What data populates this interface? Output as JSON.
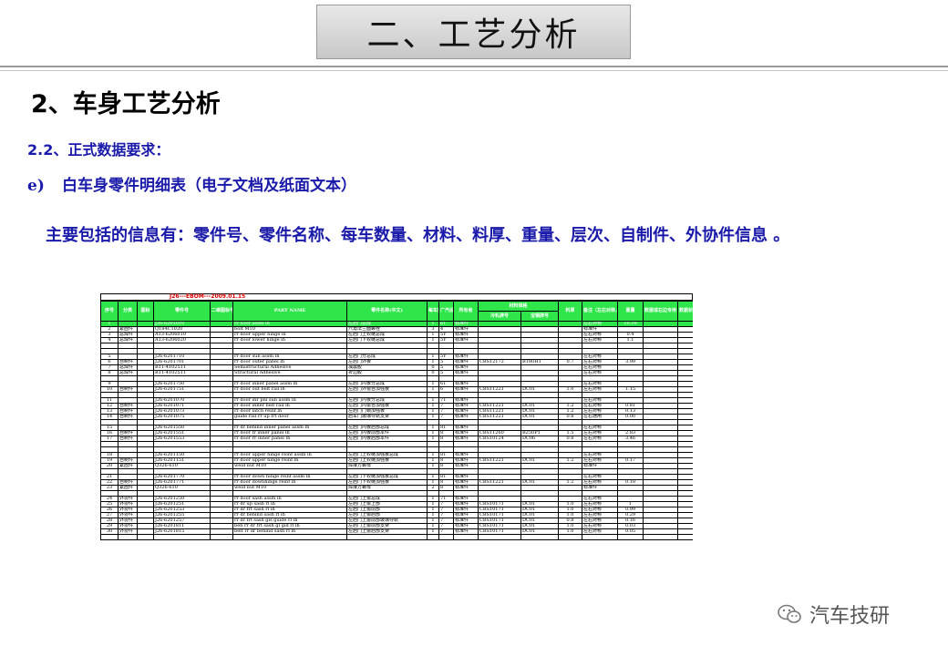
{
  "slide": {
    "title": "二、工艺分析",
    "heading": "2、车身工艺分析",
    "subheading": "2.2、正式数据要求：",
    "item_marker": "e)",
    "item_text": "白车身零件明细表（电子文档及纸面文本）",
    "paragraph": "主要包括的信息有：零件号、零件名称、每车数量、材料、料厚、重量、层次、自制件、外协件信息 。"
  },
  "sheet": {
    "title": "J26---EBOM---2009.01.15",
    "headers": [
      "序号",
      "分类",
      "图标",
      "零件号",
      "二维图标号",
      "PART NAME",
      "零件名称(中文)",
      "每车数量",
      "广汽设计的标识",
      "所有者",
      "冷轧牌号",
      "宝钢牌号",
      "料厚",
      "备注（左右对称，标准件）",
      "重量",
      "数据或右边专用",
      "数据状态（如是是否填写为\"Y\"）"
    ],
    "material_group": "材料规格",
    "rows": [
      [
        "1",
        "",
        "",
        "J26-6201010",
        "",
        "rr door assm lh",
        "左后门总成",
        "1",
        "6T",
        "标准件",
        "",
        "",
        "",
        "左右对称",
        "10.39",
        "",
        ""
      ],
      [
        "2",
        "紧固件",
        "",
        "Q184C1020",
        "",
        "bolt M10",
        "六角法兰面螺栓",
        "3",
        "4",
        "标准件",
        "",
        "",
        "",
        "标准件",
        "",
        "",
        ""
      ],
      [
        "3",
        "总焊件",
        "",
        "A13-6206010",
        "",
        "rr door upper hinge lh",
        "左后门上铰链总成",
        "1",
        "5Y",
        "标准件",
        "",
        "",
        "",
        "左右对称",
        "0.4",
        "",
        ""
      ],
      [
        "4",
        "总焊件",
        "",
        "A13-6206020",
        "",
        "rr door lower hinge lh",
        "左后门下铰链总成",
        "1",
        "5Y",
        "标准件",
        "",
        "",
        "",
        "左右对称",
        "1.1",
        "",
        ""
      ],
      [
        "",
        "",
        "",
        "",
        "",
        "",
        "",
        "",
        "",
        "",
        "",
        "",
        "",
        "",
        "",
        "",
        ""
      ],
      [
        "",
        "",
        "",
        "",
        "",
        "",
        "",
        "",
        "",
        "",
        "",
        "",
        "",
        "",
        "",
        "",
        ""
      ],
      [
        "5",
        "",
        "",
        "J26-6201710",
        "",
        "rr door sub assm lh",
        "左后门分总成",
        "1",
        "5Y",
        "标准件",
        "",
        "",
        "",
        "左右对称",
        "",
        "",
        ""
      ],
      [
        "6",
        "自制件",
        "",
        "J26-6201701",
        "",
        "rr door outer panel lh",
        "左后门外板",
        "1",
        "5",
        "标准件",
        "CBS12172",
        "B180H1",
        "0.7",
        "左右对称",
        "3.99",
        "",
        ""
      ],
      [
        "7",
        "总焊件",
        "",
        "B11-4102511",
        "",
        "Semistructural Adhesive",
        "减震胶",
        "0",
        "5",
        "标准件",
        "",
        "",
        "",
        "左右对称",
        "",
        "",
        ""
      ],
      [
        "8",
        "总焊件",
        "",
        "B11-4102511",
        "",
        "Structural Adhesive",
        "折边胶",
        "0",
        "5",
        "标准件",
        "",
        "",
        "",
        "左右对称",
        "",
        "",
        ""
      ],
      [
        "",
        "",
        "",
        "",
        "",
        "",
        "",
        "",
        "",
        "",
        "",
        "",
        "",
        "",
        "",
        "",
        ""
      ],
      [
        "9",
        "",
        "",
        "J26-6201750",
        "",
        "rr door inner panel assm lh",
        "左后门内板分总成",
        "1",
        "6T",
        "标准件",
        "",
        "",
        "",
        "左右对称",
        "",
        "",
        ""
      ],
      [
        "10",
        "自制件",
        "",
        "J26-6201751",
        "",
        "rr door out belt rail lh",
        "左后门外窗台加强板",
        "1",
        "6",
        "标准件",
        "CBS11221",
        "DC01",
        "1.0",
        "左右对称",
        "1.15",
        "",
        ""
      ],
      [
        "",
        "",
        "",
        "",
        "",
        "",
        "",
        "",
        "",
        "",
        "",
        "",
        "",
        "",
        "",
        "",
        ""
      ],
      [
        "11",
        "",
        "",
        "J26-6201070",
        "",
        "rr door inr pnl sub assm lh",
        "左后门内板分总成",
        "1",
        "7T",
        "标准件",
        "",
        "",
        "",
        "左右对称",
        "",
        "",
        ""
      ],
      [
        "12",
        "自制件",
        "",
        "J26-6201071",
        "",
        "rr door inner belt rail lh",
        "左后门内窗台加强板",
        "1",
        "7",
        "标准件",
        "CBS11221",
        "DC01",
        "1.2",
        "左右对称",
        "0.81",
        "",
        ""
      ],
      [
        "13",
        "自制件",
        "",
        "J26-6201073",
        "",
        "rr door latch reinf lh",
        "左后门门锁加强板",
        "1",
        "7",
        "标准件",
        "CBS11221",
        "DC01",
        "1.2",
        "左右对称",
        "0.13",
        "",
        ""
      ],
      [
        "14",
        "自制件",
        "",
        "J26-6201075",
        "",
        "guide rail rr up frt door",
        "后车门玻璃导轨支架",
        "1",
        "7",
        "标准件",
        "CBS11221",
        "DC01",
        "0.8",
        "左右通用",
        "0.00",
        "",
        ""
      ],
      [
        "",
        "",
        "",
        "",
        "",
        "",
        "",
        "",
        "",
        "",
        "",
        "",
        "",
        "",
        "",
        "",
        ""
      ],
      [
        "15",
        "",
        "",
        "J26-6201550",
        "",
        "rr dr behind inner panel assm lh",
        "左后门内板后部总成",
        "1",
        "8T",
        "标准件",
        "",
        "",
        "",
        "左右对称",
        "",
        "",
        ""
      ],
      [
        "16",
        "自制件",
        "",
        "J26-6201551",
        "",
        "rr door fr inner panel lh",
        "左后门内板前部本件",
        "1",
        "8",
        "标准件",
        "CBS11260",
        "B250P1",
        "1.5",
        "左右对称",
        "2.83",
        "",
        ""
      ],
      [
        "17",
        "自制件",
        "",
        "J26-6201553",
        "",
        "rr door rr inner panel lh",
        "左后门内板后部本件",
        "1",
        "8",
        "标准件",
        "CBS10124",
        "DC06",
        "0.8",
        "左右对称",
        "3.46",
        "",
        ""
      ],
      [
        "",
        "",
        "",
        "",
        "",
        "",
        "",
        "",
        "",
        "",
        "",
        "",
        "",
        "",
        "",
        "",
        ""
      ],
      [
        "",
        "",
        "",
        "",
        "",
        "",
        "",
        "",
        "",
        "",
        "",
        "",
        "",
        "",
        "",
        "",
        ""
      ],
      [
        "18",
        "",
        "",
        "J26-6201150",
        "",
        "rr door upper hinge reinf assm lh",
        "左后门上铰链加强板总成",
        "1",
        "8T",
        "标准件",
        "",
        "",
        "",
        "左右对称",
        "",
        "",
        ""
      ],
      [
        "19",
        "自制件",
        "",
        "J26-6201151",
        "",
        "rr door upper hinge reinf lh",
        "左后门上铰链加强板",
        "1",
        "8",
        "标准件",
        "CBS11221",
        "DC01",
        "1.2",
        "左右对称",
        "0.17",
        "",
        ""
      ],
      [
        "20",
        "紧固件",
        "",
        "Q326-610",
        "",
        "weld nut M10",
        "焊接方螺母",
        "1",
        "8",
        "标准件",
        "",
        "",
        "",
        "标准件",
        "",
        "",
        ""
      ],
      [
        "",
        "",
        "",
        "",
        "",
        "",
        "",
        "",
        "",
        "",
        "",
        "",
        "",
        "",
        "",
        "",
        ""
      ],
      [
        "21",
        "",
        "",
        "J26-6201770",
        "",
        "rr door down hinge reinf assm lh",
        "左后门下铰链加强板总成",
        "1",
        "8T",
        "标准件",
        "",
        "",
        "",
        "左右对称",
        "",
        "",
        ""
      ],
      [
        "22",
        "自制件",
        "",
        "J26-6201771",
        "",
        "rr door downhinge reinf lh",
        "左后门下铰链加强板",
        "1",
        "8",
        "标准件",
        "CBS11221",
        "DC01",
        "1.2",
        "左右对称",
        "0.18",
        "",
        ""
      ],
      [
        "23",
        "紧固件",
        "",
        "Q326-610",
        "",
        "weld nut M10",
        "焊接方螺母",
        "2",
        "8",
        "标准件",
        "",
        "",
        "",
        "标准件",
        "",
        "",
        ""
      ],
      [
        "",
        "",
        "",
        "",
        "",
        "",
        "",
        "",
        "",
        "",
        "",
        "",
        "",
        "",
        "",
        "",
        ""
      ],
      [
        "24",
        "外协件",
        "",
        "J26-6201250",
        "",
        "rr door sash assm lh",
        "左后门上窗总成",
        "1",
        "7T",
        "标准件",
        "",
        "",
        "",
        "左右对称",
        "",
        "",
        ""
      ],
      [
        "25",
        "外协件",
        "",
        "J26-6201251",
        "",
        "rr dr up sash rl lh",
        "左后门上窗上部",
        "1",
        "7",
        "标准件",
        "CBS10171",
        "DC01",
        "1.0",
        "左右对称",
        "1",
        "",
        ""
      ],
      [
        "26",
        "外协件",
        "",
        "J26-6201253",
        "",
        "rr dr frt sash rl lh",
        "左后门上窗前部",
        "1",
        "7",
        "标准件",
        "CBS10171",
        "DC01",
        "1.0",
        "左右对称",
        "0.99",
        "",
        ""
      ],
      [
        "27",
        "外协件",
        "",
        "J26-6201255",
        "",
        "rr dr behind sash rl lh",
        "左后门上窗后部",
        "1",
        "7",
        "标准件",
        "CBS10171",
        "DC01",
        "1.0",
        "左右对称",
        "0.29",
        "",
        ""
      ],
      [
        "28",
        "外协件",
        "",
        "J26-6201257",
        "",
        "rr dr frt sash gls guide rl lh",
        "左后门上窗前部玻璃导轨",
        "1",
        "7",
        "标准件",
        "CBS10171",
        "DC01",
        "0.8",
        "左右对称",
        "0.16",
        "",
        ""
      ],
      [
        "29",
        "外协件",
        "",
        "J26-6201811",
        "",
        "beh rr dr frt sash gl gid rl lh",
        "左后门上窗前部支架",
        "1",
        "7",
        "标准件",
        "CBS10171",
        "DC01",
        "1.0",
        "左右对称",
        "0.03",
        "",
        ""
      ],
      [
        "30",
        "外协件",
        "",
        "J26-6201815",
        "",
        "belt rr dr behind sash rl lh",
        "左后门上窗后部支架",
        "1",
        "7",
        "标准件",
        "CBS10171",
        "DC01",
        "1.0",
        "左右对称",
        "0.05",
        "",
        ""
      ],
      [
        "",
        "",
        "",
        "",
        "",
        "",
        "",
        "",
        "",
        "",
        "",
        "",
        "",
        "",
        "",
        "",
        ""
      ]
    ]
  },
  "watermark": {
    "text": "汽车技研",
    "icon": "wechat-icon"
  }
}
